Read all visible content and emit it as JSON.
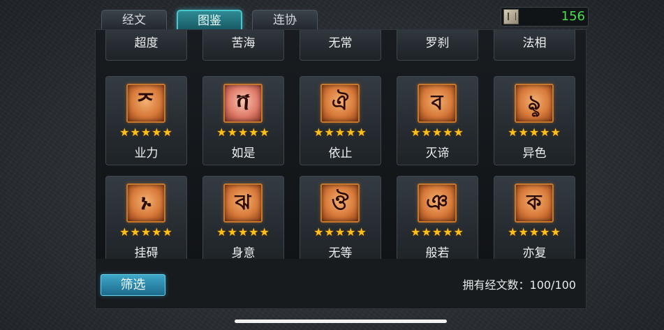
{
  "tabs": [
    {
      "label": "经文"
    },
    {
      "label": "图鉴"
    },
    {
      "label": "连协"
    }
  ],
  "currency": {
    "value": "156"
  },
  "rows": {
    "partial": [
      {
        "name": "超度"
      },
      {
        "name": "苦海"
      },
      {
        "name": "无常"
      },
      {
        "name": "罗刹"
      },
      {
        "name": "法相"
      }
    ],
    "row1": [
      {
        "name": "业力",
        "glyph": "ᅎ",
        "stars": "★★★★★"
      },
      {
        "name": "如是",
        "glyph": "ቫ",
        "stars": "★★★★★"
      },
      {
        "name": "依止",
        "glyph": "ঐ",
        "stars": "★★★★★"
      },
      {
        "name": "灭谛",
        "glyph": "ব",
        "stars": "★★★★★"
      },
      {
        "name": "异色",
        "glyph": "ৡ",
        "stars": "★★★★★"
      }
    ],
    "row2": [
      {
        "name": "挂碍",
        "glyph": "ኑ",
        "stars": "★★★★★"
      },
      {
        "name": "身意",
        "glyph": "ঝ",
        "stars": "★★★★★"
      },
      {
        "name": "无等",
        "glyph": "ঔ",
        "stars": "★★★★★"
      },
      {
        "name": "般若",
        "glyph": "ঞ",
        "stars": "★★★★★"
      },
      {
        "name": "亦复",
        "glyph": "ক",
        "stars": "★★★★★"
      }
    ]
  },
  "footer": {
    "filter_label": "筛选",
    "count_text": "拥有经文数：100/100"
  }
}
